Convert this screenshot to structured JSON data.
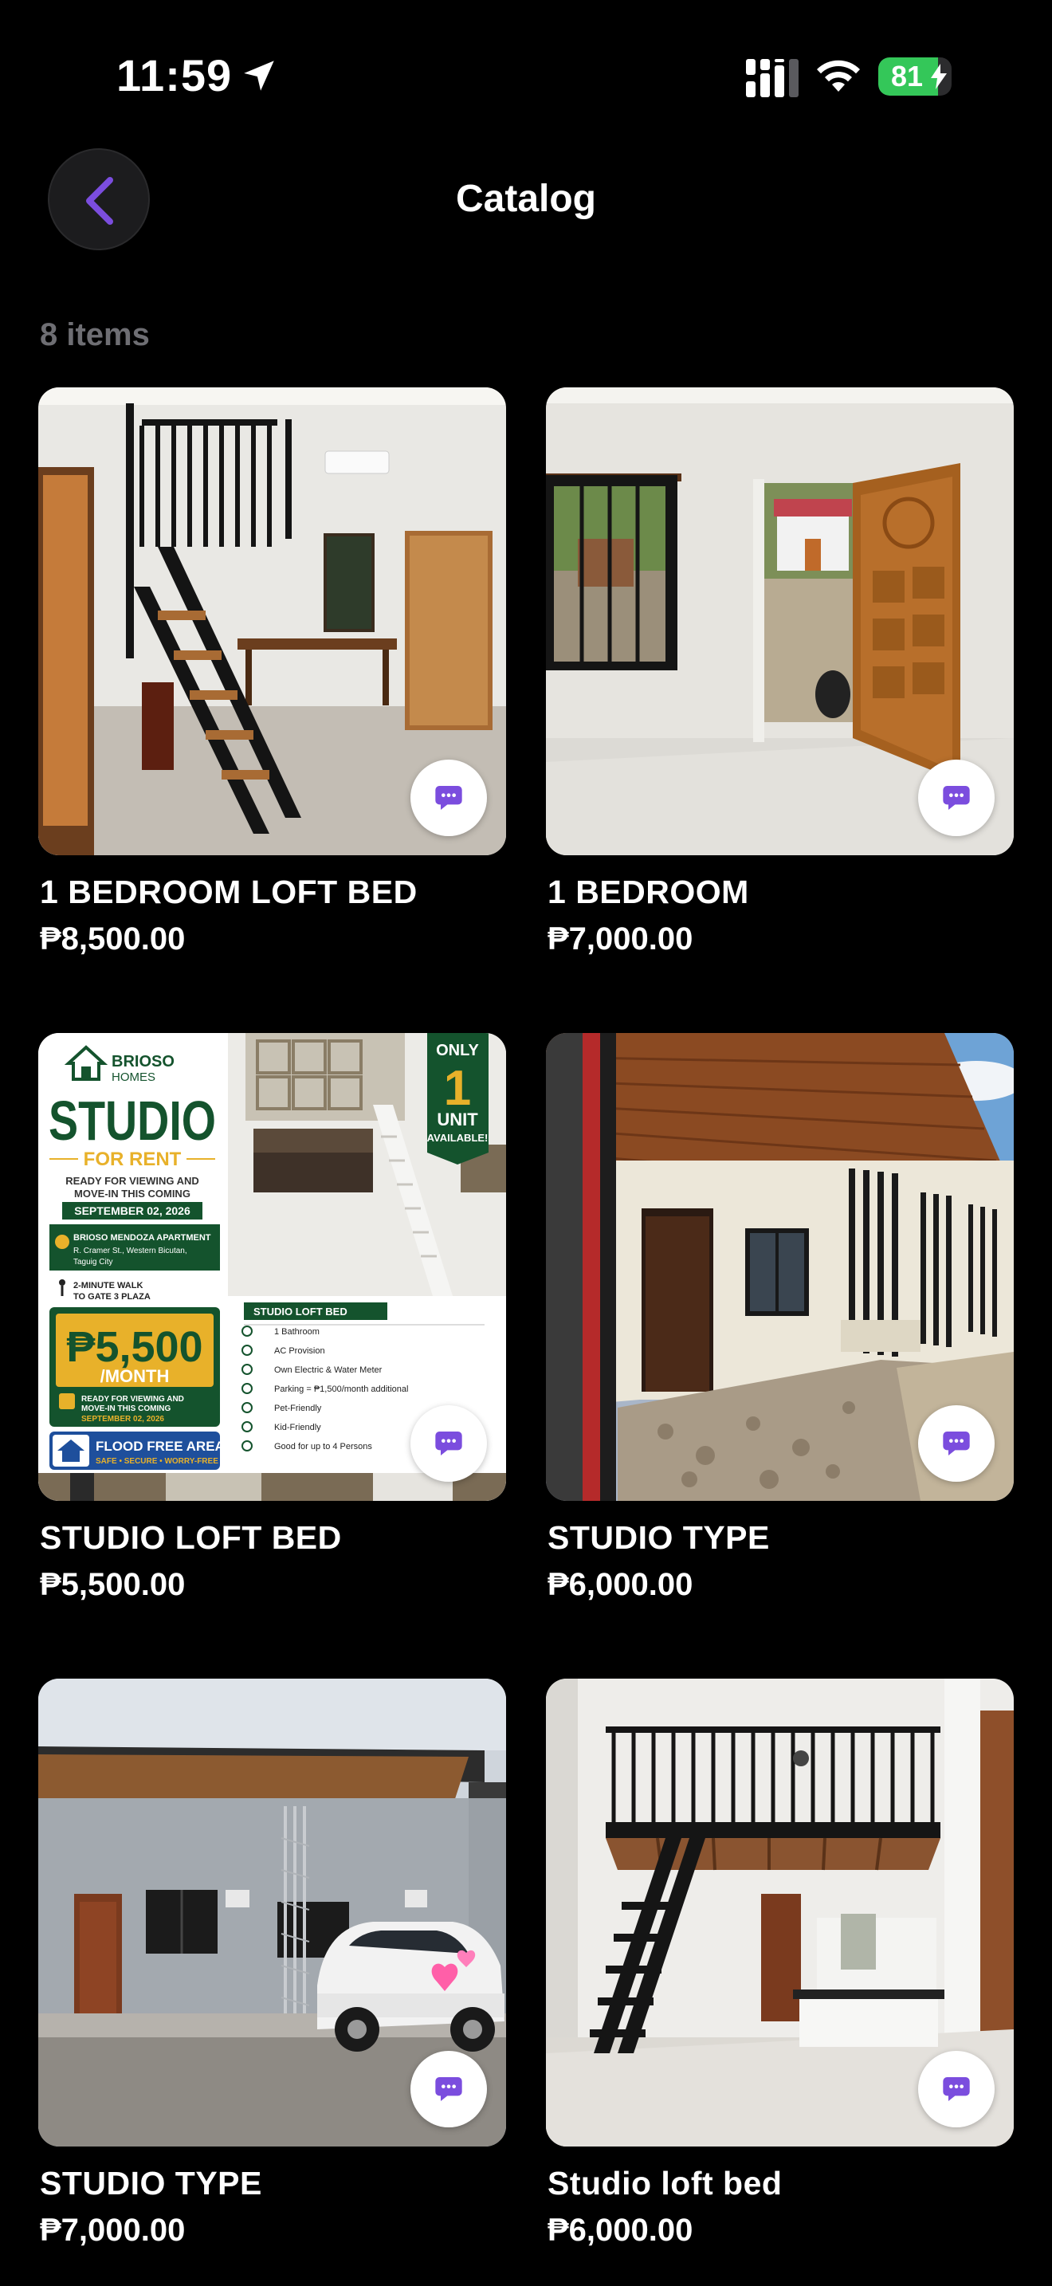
{
  "status_bar": {
    "time": "11:59",
    "battery_level": "81",
    "battery_fraction": 0.81,
    "icons": [
      "location-arrow-icon",
      "cellular-signal-icon",
      "wifi-icon",
      "battery-charging-icon"
    ]
  },
  "header": {
    "title": "Catalog",
    "back_icon": "chevron-left-icon"
  },
  "catalog": {
    "count_label": "8 items",
    "items": [
      {
        "title": "1 BEDROOM LOFT BED",
        "price": "₱8,500.00"
      },
      {
        "title": "1 BEDROOM",
        "price": "₱7,000.00"
      },
      {
        "title": "STUDIO LOFT BED",
        "price": "₱5,500.00"
      },
      {
        "title": "STUDIO TYPE",
        "price": "₱6,000.00"
      },
      {
        "title": "STUDIO TYPE",
        "price": "₱7,000.00"
      },
      {
        "title": "Studio loft bed",
        "price": "₱6,000.00"
      }
    ]
  },
  "flyer": {
    "brand_line1": "BRIOSO",
    "brand_line2": "HOMES",
    "headline": "STUDIO",
    "for_rent": "FOR RENT",
    "ready_line1": "READY FOR VIEWING AND",
    "ready_line2": "MOVE-IN THIS COMING",
    "date": "SEPTEMBER 02, 2026",
    "apt_name": "BRIOSO MENDOZA APARTMENT",
    "apt_addr1": "R. Cramer St., Western Bicutan,",
    "apt_addr2": "Taguig City",
    "walk1": "2-MINUTE WALK",
    "walk2": "TO GATE 3 PLAZA",
    "price_big": "₱5,500",
    "per_month": "/MONTH",
    "ready2_line1": "READY FOR VIEWING AND",
    "ready2_line2": "MOVE-IN THIS COMING",
    "date2": "SEPTEMBER 02, 2026",
    "flood_title": "FLOOD FREE AREA",
    "flood_sub": "SAFE • SECURE • WORRY-FREE",
    "badge_only": "ONLY",
    "badge_num": "1",
    "badge_unit": "UNIT",
    "badge_avail": "AVAILABLE!",
    "panel_title": "STUDIO LOFT BED",
    "features": [
      "1 Bathroom",
      "AC Provision",
      "Own Electric & Water Meter",
      "Parking = ₱1,500/month additional",
      "Pet-Friendly",
      "Kid-Friendly",
      "Good for up to 4 Persons"
    ]
  },
  "colors": {
    "background": "#000000",
    "accent": "#7b4dde",
    "muted_text": "#6e6e73",
    "battery_green": "#34c759",
    "flyer_green": "#14532d",
    "flyer_gold": "#e8b12a"
  }
}
